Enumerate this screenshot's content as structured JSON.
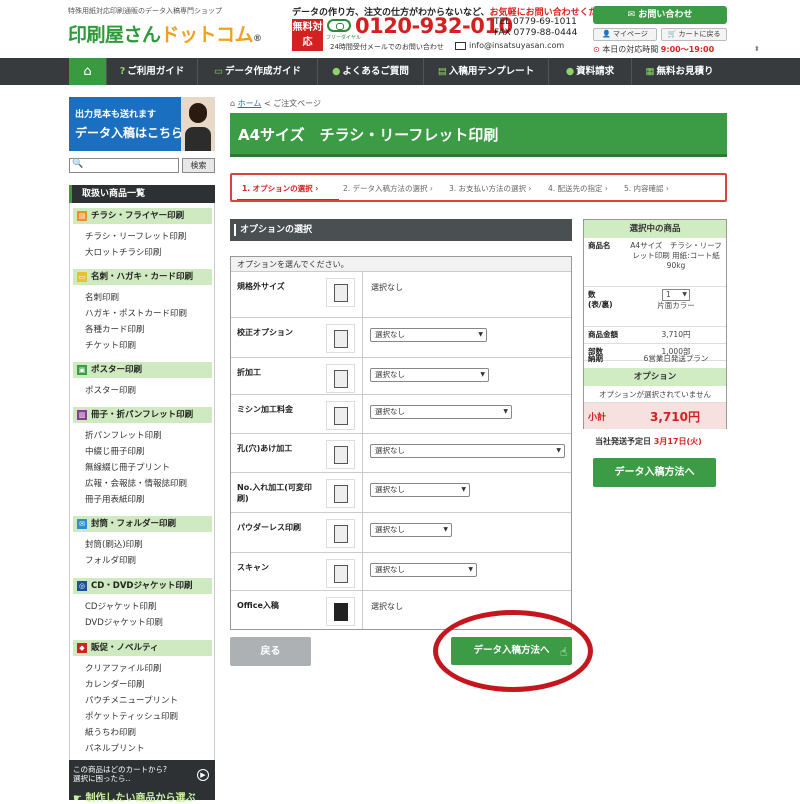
{
  "header": {
    "tagline": "特殊用紙対応印刷通販のデータ入稿専門ショップ",
    "logo_main": "印刷屋さん",
    "logo_accent": "ドットコム",
    "logo_mark": "®",
    "headline_a": "データの作り方、注文の仕方がわからないなど、",
    "headline_b": "お気軽にお問い合わせください!",
    "free_badge": "無料対応",
    "freedial_label": "フリーダイヤル",
    "phone": "0120-932-010",
    "tel": "TEL 0779-69-1011",
    "fax": "FAX 0779-88-0444",
    "reception": "24時間受付メールでのお問い合わせ",
    "email": "info@insatsuyasan.com",
    "contact_button": "お問い合わせ",
    "mypage_button": "マイページ",
    "cart_button": "カートに戻る",
    "hours_label": "本日の対応時間",
    "hours_value": "9:00～19:00"
  },
  "nav": {
    "items": [
      "ご利用ガイド",
      "データ作成ガイド",
      "よくあるご質問",
      "入稿用テンプレート",
      "資料請求",
      "無料お見積り"
    ]
  },
  "sidebar": {
    "banner_line1": "出力見本も送れます",
    "banner_line2": "データ入稿はこちら",
    "search_placeholder": "",
    "search_button": "検索",
    "category_title": "取扱い商品一覧",
    "sections": [
      {
        "title": "チラシ・フライヤー印刷",
        "items": [
          "チラシ・リーフレット印刷",
          "大ロットチラシ印刷"
        ]
      },
      {
        "title": "名刺・ハガキ・カード印刷",
        "items": [
          "名刺印刷",
          "ハガキ・ポストカード印刷",
          "各種カード印刷",
          "チケット印刷"
        ]
      },
      {
        "title": "ポスター印刷",
        "items": [
          "ポスター印刷"
        ]
      },
      {
        "title": "冊子・折パンフレット印刷",
        "items": [
          "折パンフレット印刷",
          "中綴じ冊子印刷",
          "無線綴じ冊子プリント",
          "広報・会報誌・情報誌印刷",
          "冊子用表紙印刷"
        ]
      },
      {
        "title": "封筒・フォルダー印刷",
        "items": [
          "封筒(刷込)印刷",
          "フォルダ印刷"
        ]
      },
      {
        "title": "CD・DVDジャケット印刷",
        "items": [
          "CDジャケット印刷",
          "DVDジャケット印刷"
        ]
      },
      {
        "title": "販促・ノベルティ",
        "items": [
          "クリアファイル印刷",
          "カレンダー印刷",
          "パウチメニュープリント",
          "ポケットティッシュ印刷",
          "紙うちわ印刷",
          "パネルプリント"
        ]
      }
    ],
    "bottom_line1": "この商品はどのカートから?",
    "bottom_line2": "選択に困ったら‥",
    "bottom_cta": "制作したい商品から選ぶ"
  },
  "breadcrumb": {
    "home": "ホーム",
    "sep": "<",
    "current": "ご注文ページ"
  },
  "page_title": "A4サイズ　チラシ・リーフレット印刷",
  "steps": [
    "1. オプションの選択",
    "2. データ入稿方法の選択",
    "3. お支払い方法の選択",
    "4. 配送先の指定",
    "5. 内容確認"
  ],
  "options": {
    "section_title": "オプションの選択",
    "note": "オプションを選んでください。",
    "rows": [
      {
        "label": "規格外サイズ",
        "type": "text",
        "value": "選択なし"
      },
      {
        "label": "校正オプション",
        "type": "select",
        "value": "選択なし"
      },
      {
        "label": "折加工",
        "type": "select",
        "value": "選択なし"
      },
      {
        "label": "ミシン加工料金",
        "type": "select",
        "value": "選択なし"
      },
      {
        "label": "孔(穴)あけ加工",
        "type": "select",
        "value": "選択なし"
      },
      {
        "label": "No.入れ加工(可変印刷)",
        "type": "select",
        "value": "選択なし"
      },
      {
        "label": "パウダーレス印刷",
        "type": "select",
        "value": "選択なし"
      },
      {
        "label": "スキャン",
        "type": "select",
        "value": "選択なし"
      },
      {
        "label": "Office入稿",
        "type": "text",
        "value": "選択なし"
      }
    ],
    "back_button": "戻る",
    "next_button": "データ入稿方法へ"
  },
  "summary": {
    "title": "選択中の商品",
    "product_label": "商品名",
    "product_value": "A4サイズ　チラシ・リーフレット印刷 用紙:コート紙90kg",
    "qty_label": "数\n(表/裏)",
    "qty_value": "1",
    "color_value": "片面カラー",
    "price_label": "商品金額",
    "price_value": "3,710円",
    "copies_label": "部数",
    "copies_value": "1,000部",
    "delivery_label": "納期",
    "delivery_value": "6営業日発送プラン",
    "option_title": "オプション",
    "option_value": "オプションが選択されていません",
    "subtotal_label": "小計",
    "subtotal_value": "3,710円",
    "ship_label": "当社発送予定日",
    "ship_value": "3月17日(火)",
    "next_button": "データ入稿方法へ"
  },
  "colors": {
    "brand_green": "#3c9b45",
    "accent_red": "#d32020",
    "nav_dark": "#373b3e"
  }
}
